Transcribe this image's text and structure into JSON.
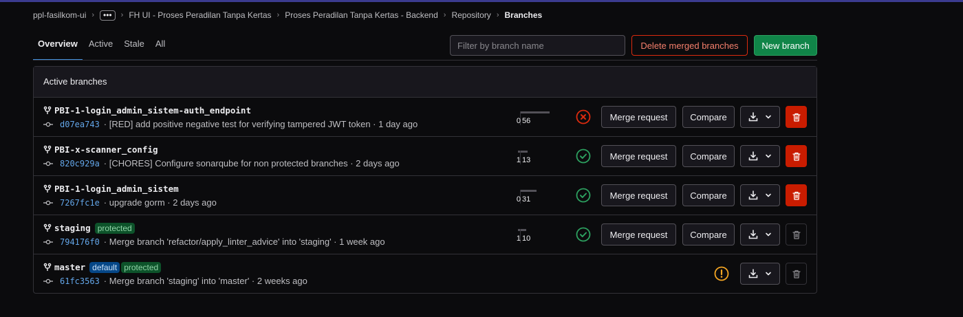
{
  "breadcrumb": {
    "items": [
      "ppl-fasilkom-ui",
      "FH UI - Proses Peradilan Tanpa Kertas",
      "Proses Peradilan Tanpa Kertas - Backend",
      "Repository"
    ],
    "current": "Branches",
    "more": "•••"
  },
  "tabs": [
    {
      "label": "Overview",
      "active": true
    },
    {
      "label": "Active",
      "active": false
    },
    {
      "label": "Stale",
      "active": false
    },
    {
      "label": "All",
      "active": false
    }
  ],
  "search": {
    "placeholder": "Filter by branch name",
    "value": ""
  },
  "actions": {
    "delete_merged": "Delete merged branches",
    "new_branch": "New branch"
  },
  "panel": {
    "title": "Active branches"
  },
  "buttons": {
    "merge_request": "Merge request",
    "compare": "Compare"
  },
  "colors": {
    "accent": "#428fdc",
    "success": "#2da160",
    "danger": "#dd2b0e",
    "warning": "#f5a623",
    "link": "#63a6e9"
  },
  "branches": [
    {
      "name": "PBI-1-login_admin_sistem-auth_endpoint",
      "badges": [],
      "sha": "d07ea743",
      "message": "· [RED] add positive negative test for verifying tampered JWT token · 1 day ago",
      "behind": "0",
      "ahead": "56",
      "pipeline": "failed",
      "deletable": true
    },
    {
      "name": "PBI-x-scanner_config",
      "badges": [],
      "sha": "820c929a",
      "message": "· [CHORES] Configure sonarqube for non protected branches · 2 days ago",
      "behind": "1",
      "ahead": "13",
      "pipeline": "passed",
      "deletable": true
    },
    {
      "name": "PBI-1-login_admin_sistem",
      "badges": [],
      "sha": "7267fc1e",
      "message": "· upgrade gorm · 2 days ago",
      "behind": "0",
      "ahead": "31",
      "pipeline": "passed",
      "deletable": true
    },
    {
      "name": "staging",
      "badges": [
        "protected"
      ],
      "sha": "794176f0",
      "message": "· Merge branch 'refactor/apply_linter_advice' into 'staging' · 1 week ago",
      "behind": "1",
      "ahead": "10",
      "pipeline": "passed",
      "deletable": false
    },
    {
      "name": "master",
      "badges": [
        "default",
        "protected"
      ],
      "sha": "61fc3563",
      "message": "· Merge branch 'staging' into 'master' · 2 weeks ago",
      "behind": "",
      "ahead": "",
      "pipeline": "warning",
      "deletable": false
    }
  ]
}
